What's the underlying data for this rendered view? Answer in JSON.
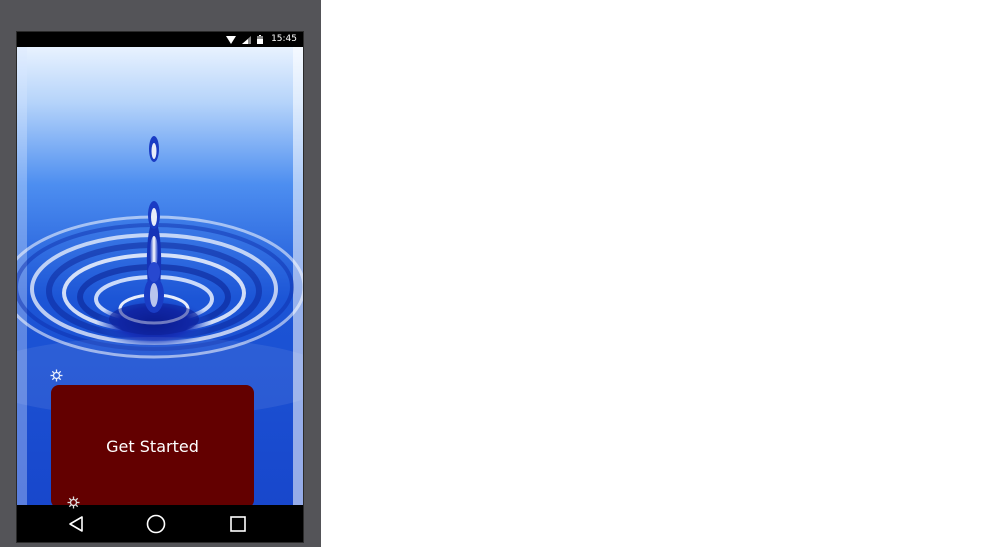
{
  "status_bar": {
    "time": "15:45",
    "icons": [
      "wifi-icon",
      "signal-icon",
      "battery-icon"
    ]
  },
  "app": {
    "background": "water-drop-splash",
    "primary_button_label": "Get Started",
    "button_color": "#630000"
  },
  "nav_bar": {
    "buttons": [
      "back-icon",
      "home-icon",
      "recents-icon"
    ]
  }
}
